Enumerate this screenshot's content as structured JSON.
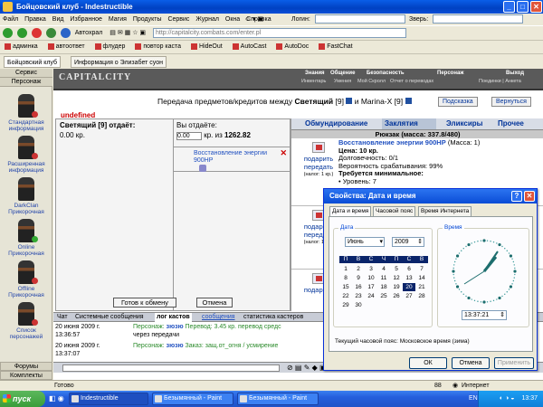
{
  "window": {
    "title": "Бойцовский клуб - Indestructible"
  },
  "menu": {
    "items": [
      "Файл",
      "Правка",
      "Вид",
      "Избранное",
      "Магия",
      "Продукты",
      "Сервис",
      "Журнал",
      "Окна",
      "Справка"
    ],
    "login_label": "Логин:",
    "nick_label": "Зверь:"
  },
  "nav": {
    "autohide": "Автохрал",
    "address": "http://capitalcity.combats.com/enter.pl"
  },
  "links": [
    "админка",
    "автоответ",
    "флудер",
    "повтор каста",
    "HideOut",
    "AutoCast",
    "AutoDoc",
    "FastChat"
  ],
  "browser_tabs": [
    "Бойцовский клуб",
    "Информация о Элизабет суон"
  ],
  "sidebar": {
    "header_service": "Сервис",
    "header_person": "Персонаж",
    "items": [
      {
        "label": "Стандартная информация"
      },
      {
        "label": "Расширенная информация"
      },
      {
        "label": "DarkClan Прикорочная"
      },
      {
        "label": "Online Прикорочная"
      },
      {
        "label": "Offline Прикорочная"
      },
      {
        "label": "Список персонажей"
      }
    ],
    "footer1": "Форумы",
    "footer2": "Комплекты"
  },
  "game": {
    "logo": "CAPITALCITY",
    "menu": [
      {
        "main": "Знания",
        "sub": "Инвентарь"
      },
      {
        "main": "Общение",
        "sub": "Умения"
      },
      {
        "main": "Безопасность",
        "sub": "Мой Скролл"
      },
      {
        "main": "Персонаж",
        "sub": "Отчет о переводах"
      },
      {
        "main": "Выход",
        "sub": "Поединки | Анкета"
      }
    ],
    "transfer_title_prefix": "Передача предметов/кредитов между",
    "player1": "Светящий",
    "player1_level": "[9]",
    "conj": "и",
    "player2": "Marina-X",
    "player2_level": "[9]",
    "hint_btn": "Подсказка",
    "back_btn": "Вернуться",
    "undefined_label": "undefined",
    "left_header": "Светящий [9] отдаёт:",
    "left_amount": "0.00 кр.",
    "you_give_label": "Вы отдаёте:",
    "you_give_value": "0.00",
    "of_label": "кр. из",
    "total_credits": "1262.82",
    "item_name_short": "Восстановление энергии 900HP",
    "ready_btn": "Готов к обмену",
    "cancel_btn": "Отмена",
    "rtabs": [
      "Обмундирование",
      "Заклятия",
      "Эликсиры",
      "Прочее"
    ],
    "backpack": "Рюкзак (масса: 337.8/480)",
    "gift_label": "подарить",
    "pass_label": "передать",
    "tax_label": "(налог: 1 кр.)",
    "item": {
      "name": "Восстановление энергии 900HP",
      "mass": "(Масса: 1)",
      "price": "Цена: 10 кр.",
      "durability": "Долговечность: 0/1",
      "chance": "Вероятность срабатывания: 99%",
      "req": "Требуется минимальное:",
      "level": "• Уровень: 7"
    },
    "chat_tabs": [
      "Чат",
      "Системные сообщения",
      "лог кастов",
      "сообщения",
      "статистика кастеров"
    ],
    "chat": [
      {
        "date": "20 июня 2009 г.",
        "time": "13:36:57",
        "prefix": "Персонаж:",
        "nick": "зюзю",
        "text": "Перевод: 3.45 кр. перевод средс",
        "tail": "через передачи"
      },
      {
        "date": "20 июня 2009 г.",
        "time": "13:37:07",
        "prefix": "Персонаж:",
        "nick": "зюзю",
        "text": "Заказ: защ.от_огня / усмирение"
      }
    ]
  },
  "dialog": {
    "title": "Свойства: Дата и время",
    "tabs": [
      "Дата и время",
      "Часовой пояс",
      "Время Интернета"
    ],
    "date_group": "Дата",
    "time_group": "Время",
    "month": "Июнь",
    "year": "2009",
    "weekdays": [
      "П",
      "В",
      "С",
      "Ч",
      "П",
      "С",
      "В"
    ],
    "days": [
      "1",
      "2",
      "3",
      "4",
      "5",
      "6",
      "7",
      "8",
      "9",
      "10",
      "11",
      "12",
      "13",
      "14",
      "15",
      "16",
      "17",
      "18",
      "19",
      "20",
      "21",
      "22",
      "23",
      "24",
      "25",
      "26",
      "27",
      "28",
      "29",
      "30"
    ],
    "today": "20",
    "time_value": "13:37:21",
    "timezone_text": "Текущий часовой пояс: Московское время (зима)",
    "ok": "ОК",
    "cancel": "Отмена",
    "apply": "Применить"
  },
  "status": {
    "left": "Готово",
    "zone": "Интернет",
    "zoom": "88"
  },
  "taskbar": {
    "start": "пуск",
    "tasks": [
      "Indestructible",
      "Безымянный - Paint",
      "Безымянный - Paint"
    ],
    "lang": "EN",
    "clock": "13:37"
  }
}
